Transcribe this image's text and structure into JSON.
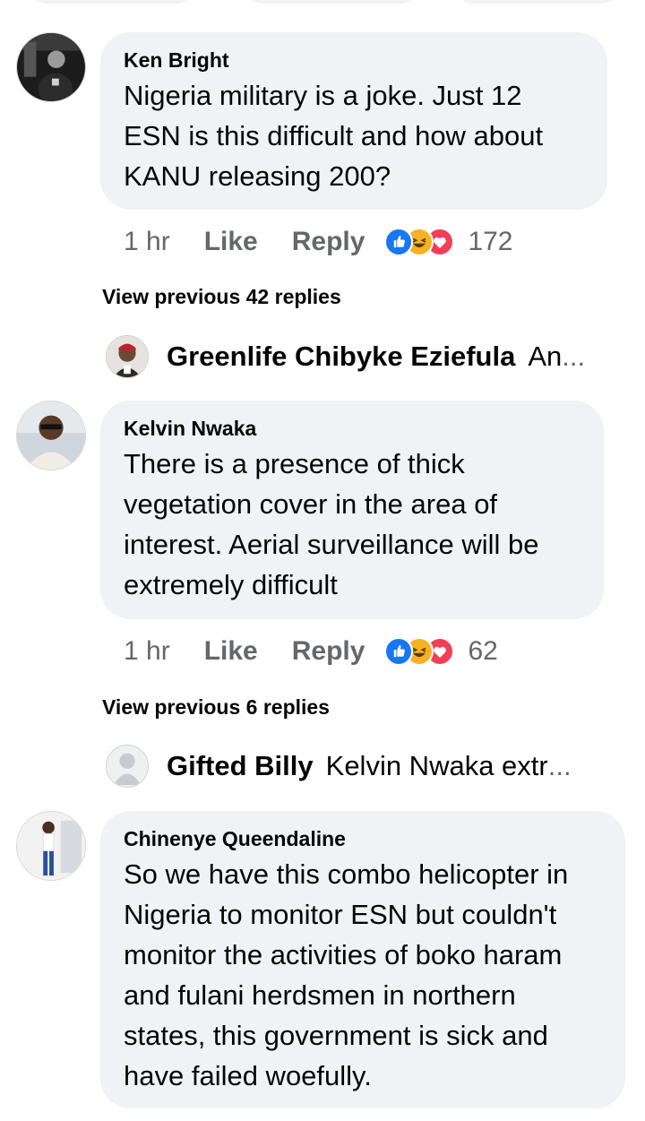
{
  "comments": [
    {
      "author": "Ken Bright",
      "text": "Nigeria military is a joke. Just 12 ESN is this difficult and how about KANU releasing 200?",
      "time": "1 hr",
      "like_label": "Like",
      "reply_label": "Reply",
      "reaction_count": "172",
      "reactions": [
        "like-icon",
        "haha-icon",
        "love-icon"
      ],
      "view_previous": "View previous 42 replies",
      "reply_preview": {
        "name": "Greenlife Chibyke Eziefula",
        "text": "An",
        "ellipsis": "..."
      }
    },
    {
      "author": "Kelvin Nwaka",
      "text": "There is a presence of thick vegetation cover in the area of interest. Aerial surveillance will be extremely difficult",
      "time": "1 hr",
      "like_label": "Like",
      "reply_label": "Reply",
      "reaction_count": "62",
      "reactions": [
        "like-icon",
        "haha-icon",
        "love-icon"
      ],
      "view_previous": "View previous 6 replies",
      "reply_preview": {
        "name": "Gifted Billy",
        "text": "Kelvin Nwaka extr",
        "ellipsis": "..."
      }
    },
    {
      "author": "Chinenye Queendaline",
      "text": "So we have this combo helicopter in Nigeria to monitor ESN but couldn't monitor the activities of boko haram and fulani herdsmen in northern states,  this government is sick and have failed woefully."
    }
  ],
  "colors": {
    "bubble": "#f0f2f5",
    "meta_text": "#65676b",
    "like_blue": "#1877f2",
    "haha_yellow": "#f7b125",
    "love_red": "#f33e58"
  }
}
